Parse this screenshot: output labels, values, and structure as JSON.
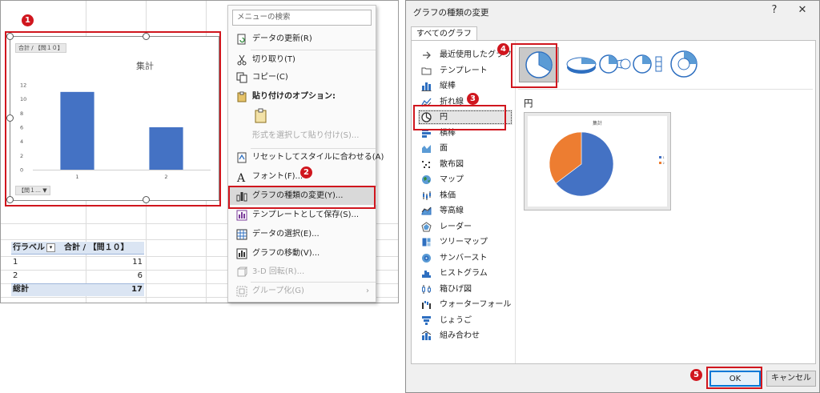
{
  "spreadsheet": {
    "chart": {
      "field_button_top": "合計 / 【問１０】",
      "field_button_bottom": "【問１…",
      "badge": "1"
    },
    "chart_data": {
      "type": "bar",
      "title": "集計",
      "categories": [
        "1",
        "2"
      ],
      "values": [
        11,
        6
      ],
      "ylim": [
        0,
        12
      ],
      "yticks": [
        "0",
        "2",
        "4",
        "6",
        "8",
        "10",
        "12"
      ],
      "color": "#4472c4",
      "grid": false
    },
    "pivot": {
      "header_label": "行ラベル",
      "header_value": "合計 / 【問１０】",
      "rows": [
        {
          "label": "1",
          "value": "11"
        },
        {
          "label": "2",
          "value": "6"
        }
      ],
      "total_label": "総計",
      "total_value": "17"
    }
  },
  "context_menu": {
    "search_placeholder": "メニューの検索",
    "items": [
      {
        "label": "データの更新(R)",
        "icon": "refresh-data-icon"
      },
      {
        "label": "切り取り(T)",
        "icon": "scissors-icon"
      },
      {
        "label": "コピー(C)",
        "icon": "copy-icon"
      },
      {
        "label": "貼り付けのオプション:",
        "icon": "paste-icon"
      },
      {
        "label": "形式を選択して貼り付け(S)...",
        "icon": ""
      },
      {
        "label": "リセットしてスタイルに合わせる(A)",
        "icon": "reset-style-icon"
      },
      {
        "label": "フォント(F)...",
        "icon": "font-icon"
      },
      {
        "label": "グラフの種類の変更(Y)...",
        "icon": "change-chart-type-icon"
      },
      {
        "label": "テンプレートとして保存(S)...",
        "icon": "save-template-icon"
      },
      {
        "label": "データの選択(E)...",
        "icon": "select-data-icon"
      },
      {
        "label": "グラフの移動(V)...",
        "icon": "move-chart-icon"
      },
      {
        "label": "3-D 回転(R)...",
        "icon": "rotate-3d-icon"
      },
      {
        "label": "グループ化(G)",
        "icon": "group-icon"
      }
    ],
    "badge": "2"
  },
  "dialog": {
    "title": "グラフの種類の変更",
    "help": "?",
    "close": "✕",
    "tab": "すべてのグラフ",
    "categories": [
      {
        "label": "最近使用したグラフ",
        "icon": "recent-icon"
      },
      {
        "label": "テンプレート",
        "icon": "template-folder-icon"
      },
      {
        "label": "縦棒",
        "icon": "column-chart-icon"
      },
      {
        "label": "折れ線",
        "icon": "line-chart-icon"
      },
      {
        "label": "円",
        "icon": "pie-chart-icon"
      },
      {
        "label": "横棒",
        "icon": "bar-chart-icon"
      },
      {
        "label": "面",
        "icon": "area-chart-icon"
      },
      {
        "label": "散布図",
        "icon": "scatter-chart-icon"
      },
      {
        "label": "マップ",
        "icon": "map-chart-icon"
      },
      {
        "label": "株価",
        "icon": "stock-chart-icon"
      },
      {
        "label": "等高線",
        "icon": "surface-chart-icon"
      },
      {
        "label": "レーダー",
        "icon": "radar-chart-icon"
      },
      {
        "label": "ツリーマップ",
        "icon": "treemap-chart-icon"
      },
      {
        "label": "サンバースト",
        "icon": "sunburst-chart-icon"
      },
      {
        "label": "ヒストグラム",
        "icon": "histogram-chart-icon"
      },
      {
        "label": "箱ひげ図",
        "icon": "box-whisker-chart-icon"
      },
      {
        "label": "ウォーターフォール",
        "icon": "waterfall-chart-icon"
      },
      {
        "label": "じょうご",
        "icon": "funnel-chart-icon"
      },
      {
        "label": "組み合わせ",
        "icon": "combo-chart-icon"
      }
    ],
    "selected_category": "円",
    "subtype_heading": "円",
    "preview_title": "集計",
    "preview_chart_data": {
      "type": "pie",
      "labels": [
        "1",
        "2"
      ],
      "values": [
        11,
        6
      ],
      "colors": [
        "#4472c4",
        "#ed7d31"
      ]
    },
    "ok": "OK",
    "cancel": "キャンセル",
    "badges": {
      "category": "3",
      "subtype": "4",
      "ok": "5"
    }
  }
}
